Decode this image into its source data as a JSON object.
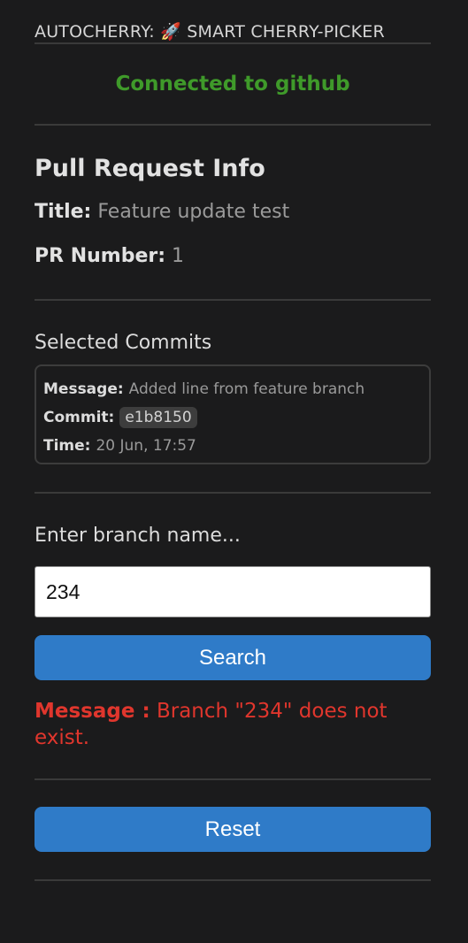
{
  "header": {
    "title": "AUTOCHERRY: 🚀 SMART CHERRY-PICKER"
  },
  "status": {
    "text": "Connected to github",
    "color": "#3f9a2a"
  },
  "pull_request": {
    "heading": "Pull Request Info",
    "title_label": "Title:",
    "title_value": "Feature update test",
    "number_label": "PR Number:",
    "number_value": "1"
  },
  "commits": {
    "heading": "Selected Commits",
    "items": [
      {
        "message_label": "Message:",
        "message": "Added line from feature branch",
        "commit_label": "Commit:",
        "hash": "e1b8150",
        "time_label": "Time:",
        "time": "20 Jun, 17:57"
      }
    ]
  },
  "branch": {
    "label": "Enter branch name...",
    "input_value": "234",
    "search_label": "Search",
    "message_label": "Message :",
    "message_text": "Branch \"234\" does not exist.",
    "error_color": "#e0362d"
  },
  "reset": {
    "label": "Reset"
  },
  "colors": {
    "background": "#1b1b1c",
    "button": "#2f7bc8"
  }
}
